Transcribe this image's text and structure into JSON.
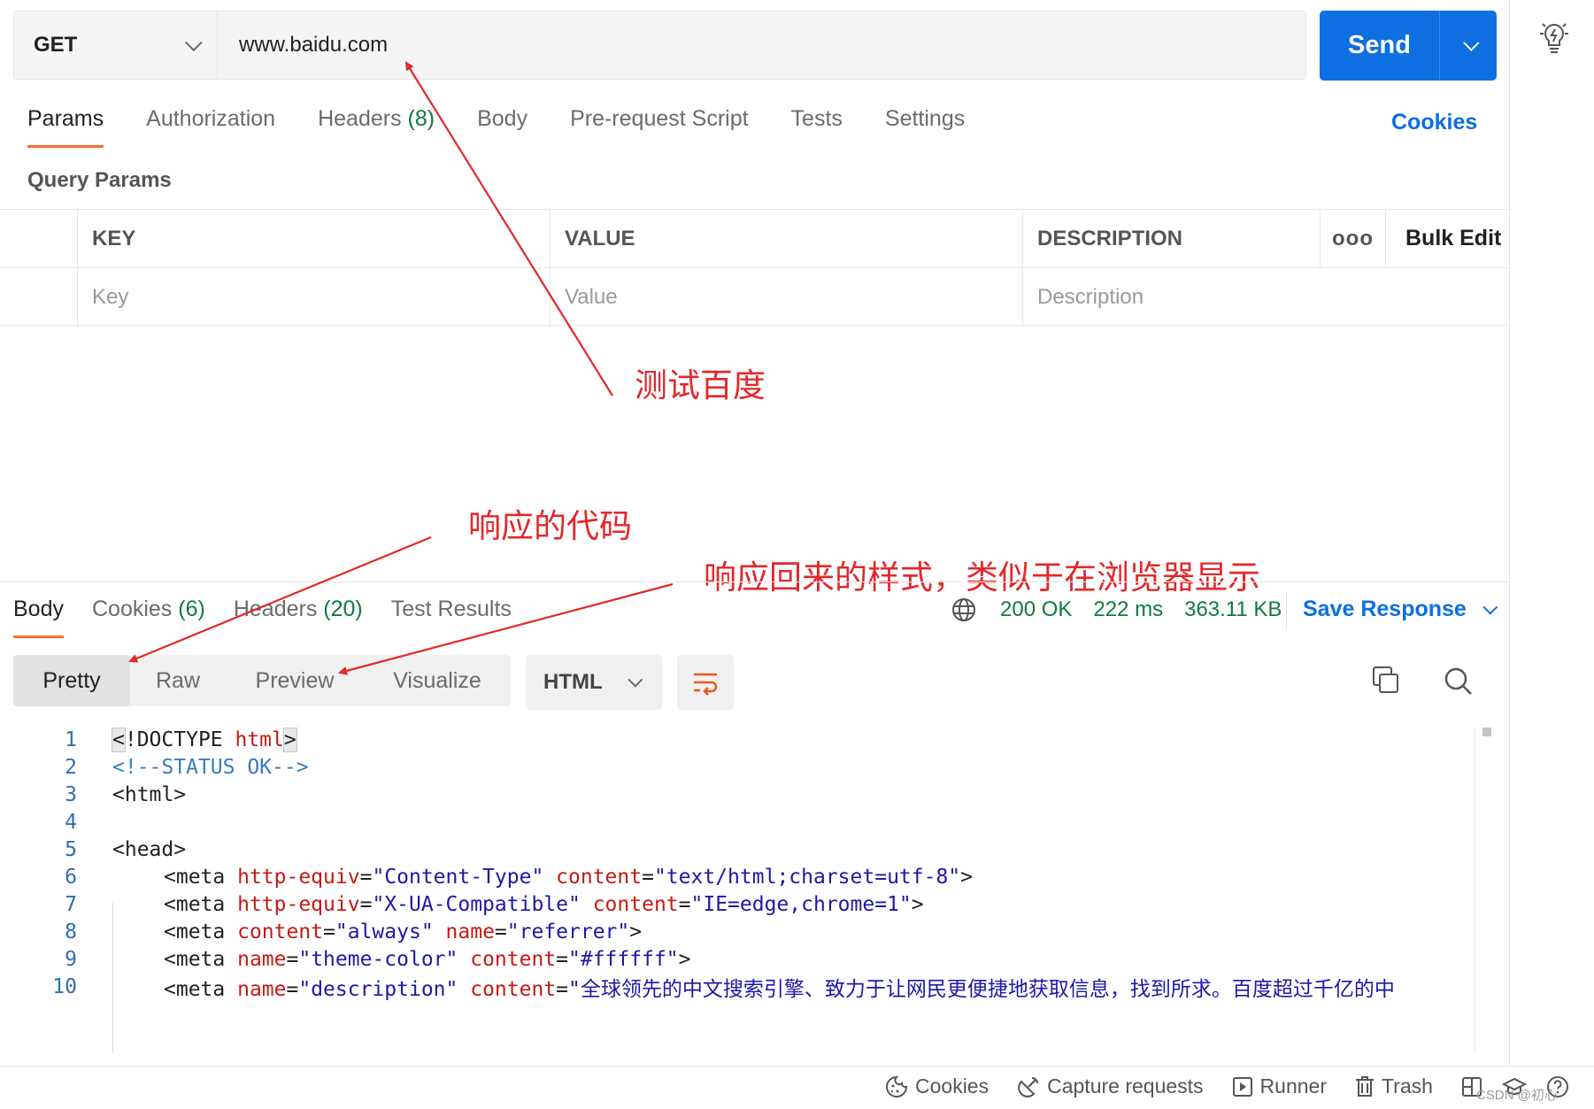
{
  "request": {
    "method": "GET",
    "url": "www.baidu.com",
    "send_label": "Send"
  },
  "request_tabs": [
    {
      "label": "Params",
      "count": ""
    },
    {
      "label": "Authorization",
      "count": ""
    },
    {
      "label": "Headers",
      "count": "(8)"
    },
    {
      "label": "Body",
      "count": ""
    },
    {
      "label": "Pre-request Script",
      "count": ""
    },
    {
      "label": "Tests",
      "count": ""
    },
    {
      "label": "Settings",
      "count": ""
    }
  ],
  "cookies_link": "Cookies",
  "query_params": {
    "title": "Query Params",
    "columns": {
      "key": "KEY",
      "value": "VALUE",
      "description": "DESCRIPTION",
      "more": "ooo",
      "bulk_edit": "Bulk Edit"
    },
    "placeholders": {
      "key": "Key",
      "value": "Value",
      "description": "Description"
    }
  },
  "annotations": {
    "test_baidu": "测试百度",
    "response_code": "响应的代码",
    "response_style": "响应回来的样式，类似于在浏览器显示"
  },
  "response_tabs": [
    {
      "label": "Body",
      "count": ""
    },
    {
      "label": "Cookies",
      "count": "(6)"
    },
    {
      "label": "Headers",
      "count": "(20)"
    },
    {
      "label": "Test Results",
      "count": ""
    }
  ],
  "response_status": {
    "status": "200 OK",
    "time": "222 ms",
    "size": "363.11 KB",
    "save_label": "Save Response"
  },
  "view_modes": [
    "Pretty",
    "Raw",
    "Preview",
    "Visualize"
  ],
  "language": "HTML",
  "code_lines": [
    {
      "n": "1"
    },
    {
      "n": "2"
    },
    {
      "n": "3"
    },
    {
      "n": "4"
    },
    {
      "n": "5"
    },
    {
      "n": "6"
    },
    {
      "n": "7"
    },
    {
      "n": "8"
    },
    {
      "n": "9"
    },
    {
      "n": "10"
    }
  ],
  "code_text": {
    "l1": [
      "<",
      "!DOCTYPE ",
      "html",
      ">"
    ],
    "l2": "<!--STATUS OK-->",
    "l3": "<html>",
    "l5": "<head>",
    "l6": [
      "<meta ",
      "http-equiv",
      "=",
      "\"Content-Type\"",
      " ",
      "content",
      "=",
      "\"text/html;charset=utf-8\"",
      ">"
    ],
    "l7": [
      "<meta ",
      "http-equiv",
      "=",
      "\"X-UA-Compatible\"",
      " ",
      "content",
      "=",
      "\"IE=edge,chrome=1\"",
      ">"
    ],
    "l8": [
      "<meta ",
      "content",
      "=",
      "\"always\"",
      " ",
      "name",
      "=",
      "\"referrer\"",
      ">"
    ],
    "l9": [
      "<meta ",
      "name",
      "=",
      "\"theme-color\"",
      " ",
      "content",
      "=",
      "\"#ffffff\"",
      ">"
    ],
    "l10": [
      "<meta ",
      "name",
      "=",
      "\"description\"",
      " ",
      "content",
      "=",
      "\"全球领先的中文搜索引擎、致力于让网民更便捷地获取信息，找到所求。百度超过千亿的中"
    ]
  },
  "footer": {
    "cookies": "Cookies",
    "capture": "Capture requests",
    "runner": "Runner",
    "trash": "Trash",
    "watermark": "CSDN @初心"
  },
  "colors": {
    "accent": "#0d6fe0",
    "active_tab": "#ff6c37",
    "status_ok": "#0f7b3b",
    "annotation": "#e4272a"
  }
}
